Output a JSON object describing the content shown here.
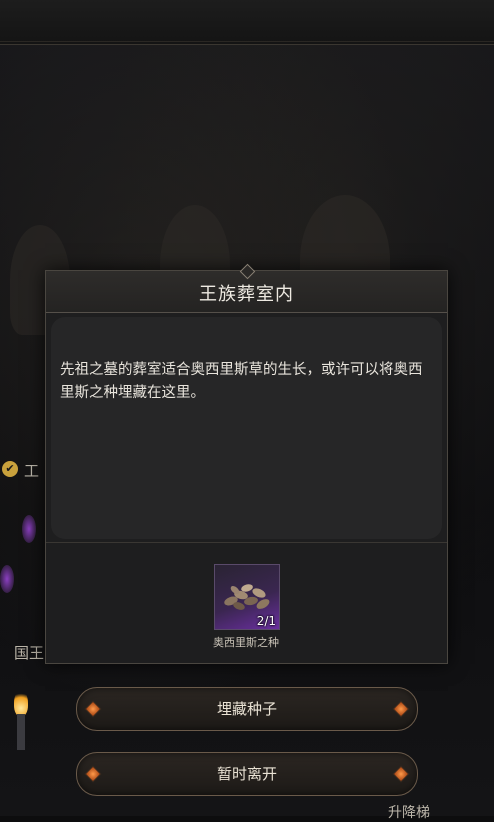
{
  "background": {
    "left_label_1": "工",
    "left_label_2": "国王",
    "right_label": "升降梯"
  },
  "dialog": {
    "title": "王族葬室内",
    "description": "先祖之墓的葬室适合奥西里斯草的生长，或许可以将奥西里斯之种埋藏在这里。",
    "item": {
      "name": "奥西里斯之种",
      "count": "2/1",
      "icon": "seed-pile-icon"
    }
  },
  "buttons": {
    "bury": "埋藏种子",
    "leave": "暂时离开"
  },
  "colors": {
    "accent_gem": "#e06a2a",
    "item_rarity": "#6a2fa0"
  }
}
